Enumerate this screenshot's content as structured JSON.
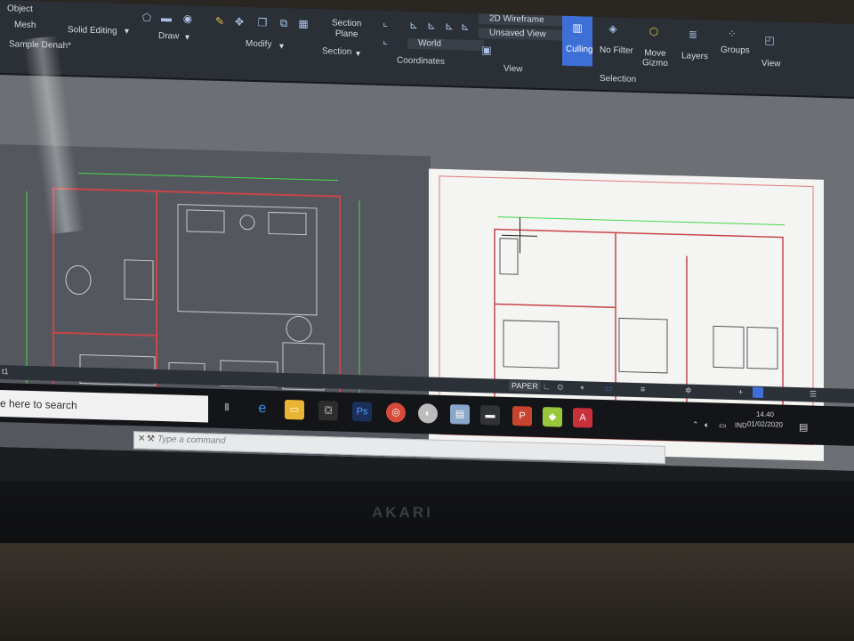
{
  "ribbon": {
    "top_left_labels": [
      "Object",
      "Mesh",
      "Solid Editing"
    ],
    "document_tab": "Sample Denah*",
    "panels": {
      "draw": "Draw",
      "modify": "Modify",
      "section": "Section",
      "coordinates": "Coordinates",
      "view": "View",
      "selection": "Selection"
    },
    "buttons": {
      "section_plane": "Section\nPlane",
      "world": "World",
      "visual_style": "2D Wireframe",
      "saved_view": "Unsaved View",
      "culling": "Culling",
      "no_filter": "No Filter",
      "move_gizmo": "Move\nGizmo",
      "layers": "Layers",
      "groups": "Groups",
      "view": "View"
    }
  },
  "command_line": {
    "placeholder": "Type a command"
  },
  "status_bar": {
    "paper": "PAPER"
  },
  "layout_tab": "t1",
  "taskbar": {
    "search_placeholder": "e here to search",
    "language": "IND",
    "time": "14.40",
    "date": "01/02/2020"
  },
  "monitor_brand": "AKARI",
  "colors": {
    "ribbon_bg": "#2b2f36",
    "model_space_bg": "#54585e",
    "paper_bg": "#f4f4f2",
    "wall_red": "#c9434a",
    "dimension_green": "#48d84a",
    "selection_blue": "#3d6fd6"
  }
}
